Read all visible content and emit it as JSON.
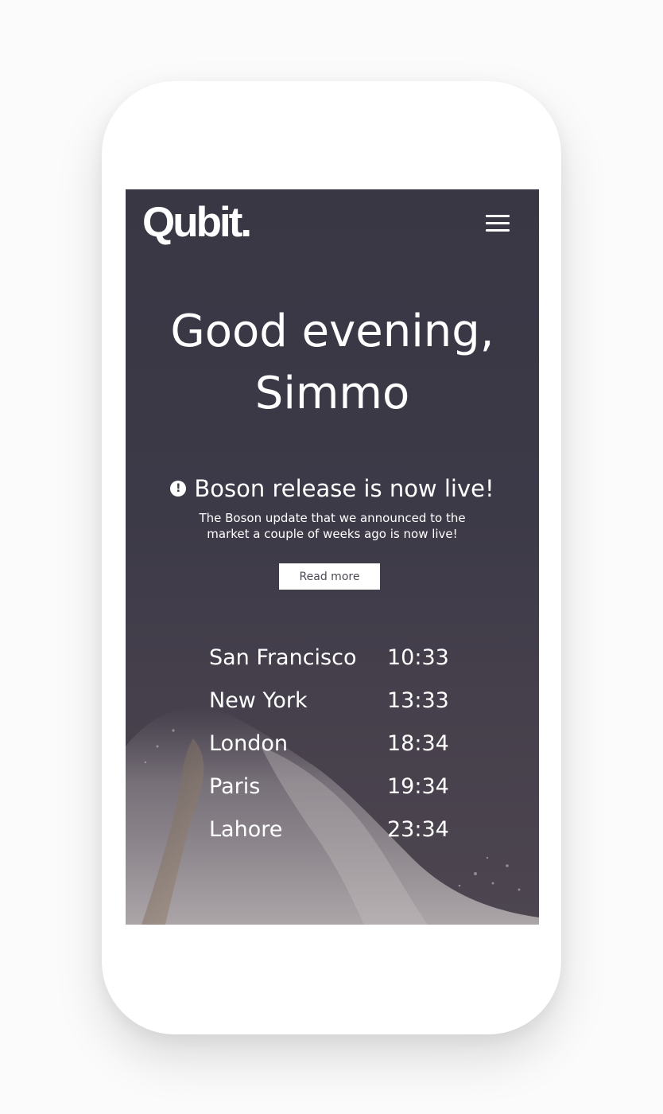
{
  "header": {
    "logo": "Qubit.",
    "menu_icon": "hamburger-menu-icon"
  },
  "hero": {
    "greeting": "Good evening, Simmo"
  },
  "announcement": {
    "icon": "alert-circle-icon",
    "icon_glyph": "!",
    "title": "Boson release is now live!",
    "description": "The Boson update that we announced to the market a couple of weeks ago is now live!",
    "button_label": "Read more"
  },
  "clocks": [
    {
      "city": "San Francisco",
      "time": "10:33"
    },
    {
      "city": "New York",
      "time": "13:33"
    },
    {
      "city": "London",
      "time": "18:34"
    },
    {
      "city": "Paris",
      "time": "19:34"
    },
    {
      "city": "Lahore",
      "time": "23:34"
    }
  ],
  "colors": {
    "background_overlay": "#3c3946",
    "text": "#ffffff",
    "button_bg": "#ffffff",
    "button_text": "#4a4a55"
  }
}
